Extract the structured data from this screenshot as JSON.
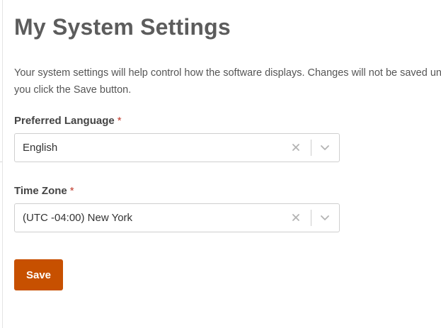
{
  "page": {
    "title": "My System Settings",
    "description": "Your system settings will help control how the software displays. Changes will not be saved until you click the Save button."
  },
  "fields": {
    "language": {
      "label": "Preferred Language",
      "required_marker": "*",
      "value": "English"
    },
    "timezone": {
      "label": "Time Zone",
      "required_marker": "*",
      "value": "(UTC -04:00) New York"
    }
  },
  "actions": {
    "save_label": "Save"
  },
  "colors": {
    "accent": "#c75000",
    "required": "#c0392b",
    "title": "#5c5c5c"
  },
  "icons": {
    "clear": "close-icon",
    "dropdown": "chevron-down-icon"
  }
}
